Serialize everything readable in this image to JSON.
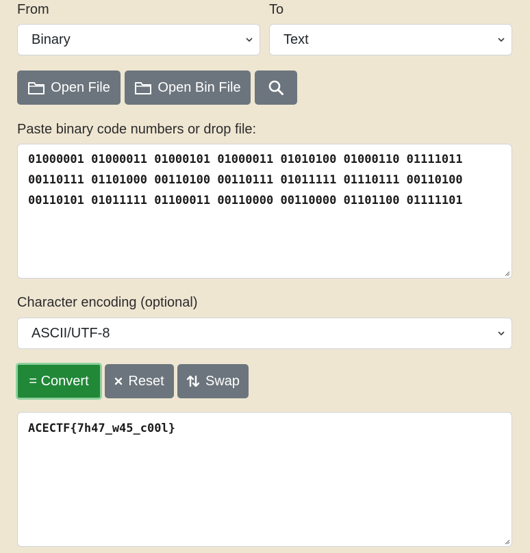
{
  "from": {
    "label": "From",
    "selected": "Binary"
  },
  "to": {
    "label": "To",
    "selected": "Text"
  },
  "toolbar": {
    "open_file": "Open File",
    "open_bin_file": "Open Bin File"
  },
  "input": {
    "label": "Paste binary code numbers or drop file:",
    "lines": [
      "01000001 01000011 01000101 01000011 01010100 01000110 01111011",
      "00110111 01101000 00110100 00110111 01011111 01110111 00110100",
      "00110101 01011111 01100011 00110000 00110000 01101100 01111101"
    ]
  },
  "encoding": {
    "label": "Character encoding (optional)",
    "selected": "ASCII/UTF-8"
  },
  "actions": {
    "convert": "= Convert",
    "reset": "Reset",
    "swap": "Swap"
  },
  "output": {
    "value": "ACECTF{7h47_w45_c00l}"
  },
  "colors": {
    "background": "#efe6d2",
    "button_gray": "#6c757d",
    "convert_green": "#218838"
  }
}
